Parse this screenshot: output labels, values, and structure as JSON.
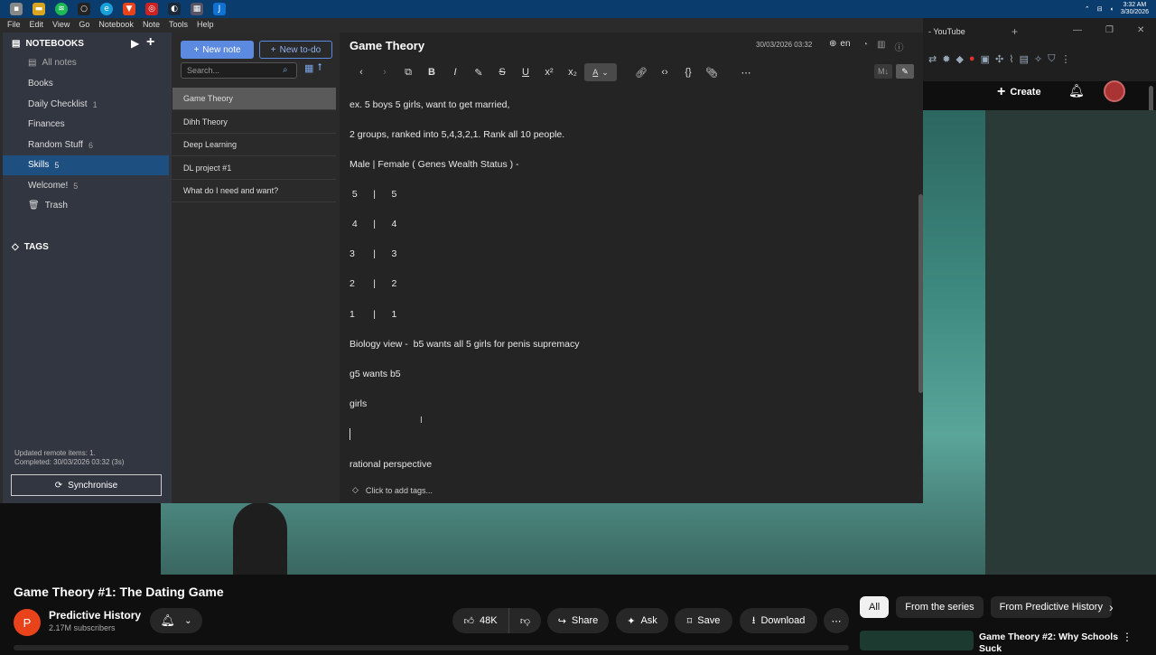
{
  "taskbar": {
    "time": "3:32 AM",
    "date": "3/30/2026"
  },
  "browser": {
    "tab_title": "- YouTube"
  },
  "youtube": {
    "create_label": "Create",
    "video_title": "Game Theory #1: The Dating Game",
    "channel_initial": "P",
    "channel_name": "Predictive History",
    "subscribers": "2.17M subscribers",
    "likes": "48K",
    "share_label": "Share",
    "ask_label": "Ask",
    "save_label": "Save",
    "download_label": "Download",
    "filters": [
      "All",
      "From the series",
      "From Predictive History"
    ],
    "recommended_title": "Game Theory #2:  Why Schools Suck"
  },
  "joplin": {
    "menu": [
      "File",
      "Edit",
      "View",
      "Go",
      "Notebook",
      "Note",
      "Tools",
      "Help"
    ],
    "notebooks_header": "NOTEBOOKS",
    "all_notes": "All notes",
    "notebooks": [
      {
        "name": "Books",
        "count": ""
      },
      {
        "name": "Daily Checklist",
        "count": "1"
      },
      {
        "name": "Finances",
        "count": ""
      },
      {
        "name": "Random Stuff",
        "count": "6"
      },
      {
        "name": "Skills",
        "count": "5"
      },
      {
        "name": "Welcome!",
        "count": "5"
      },
      {
        "name": "Trash",
        "count": ""
      }
    ],
    "tags_header": "TAGS",
    "sync_status_1": "Updated remote items: 1.",
    "sync_status_2": "Completed: 30/03/2026 03:32 (3s)",
    "sync_label": "Synchronise",
    "new_note_label": "New note",
    "new_todo_label": "New to-do",
    "search_placeholder": "Search...",
    "notes": [
      "Game Theory",
      "Dihh Theory",
      "Deep Learning",
      "DL project #1",
      "What do I need and want?"
    ],
    "note_title": "Game Theory",
    "note_date": "30/03/2026 03:32",
    "language": "en",
    "body_lines": [
      "ex. 5 boys 5 girls, want to get married,",
      "2 groups, ranked into 5,4,3,2,1. Rank all 10 people.",
      "Male | Female ( Genes Wealth Status ) -",
      " 5      |      5",
      " 4      |      4",
      "3       |      3",
      "2       |      2",
      "1       |      1",
      "Biology view -  b5 wants all 5 girls for penis supremacy",
      "g5 wants b5",
      "girls",
      "rational perspective"
    ],
    "tags_placeholder": "Click to add tags..."
  }
}
